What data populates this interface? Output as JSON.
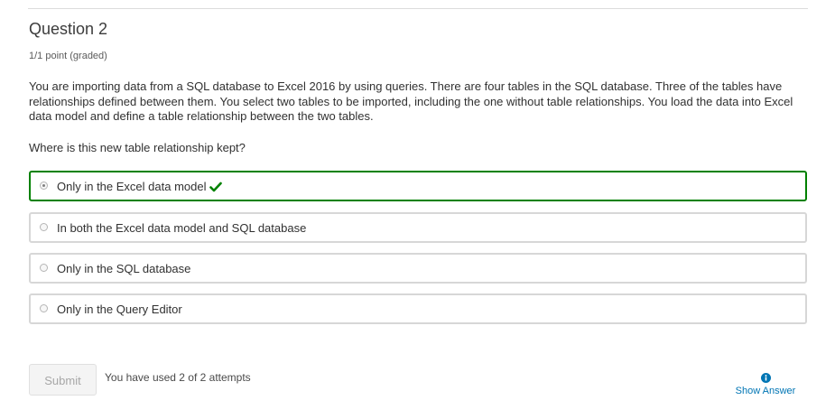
{
  "question": {
    "title": "Question 2",
    "points": "1/1 point (graded)",
    "body": "You are importing data from a SQL database to Excel 2016 by using queries. There are four tables in the SQL database. Three of the tables have relationships defined between them. You select two tables to be imported, including the one without table relationships. You load the data into Excel data model and define a table relationship between the two tables.",
    "prompt": "Where is this new table relationship kept?"
  },
  "choices": [
    {
      "label": "Only in the Excel data model"
    },
    {
      "label": "In both the Excel data model and SQL database"
    },
    {
      "label": "Only in the SQL database"
    },
    {
      "label": "Only in the Query Editor"
    }
  ],
  "footer": {
    "submit_label": "Submit",
    "attempts_text": "You have used 2 of 2 attempts",
    "show_answer_label": "Show Answer"
  },
  "colors": {
    "correct_border": "#008100",
    "link": "#0075b4"
  },
  "icons": {
    "correct": "checkmark-icon",
    "show_answer": "info-icon"
  }
}
